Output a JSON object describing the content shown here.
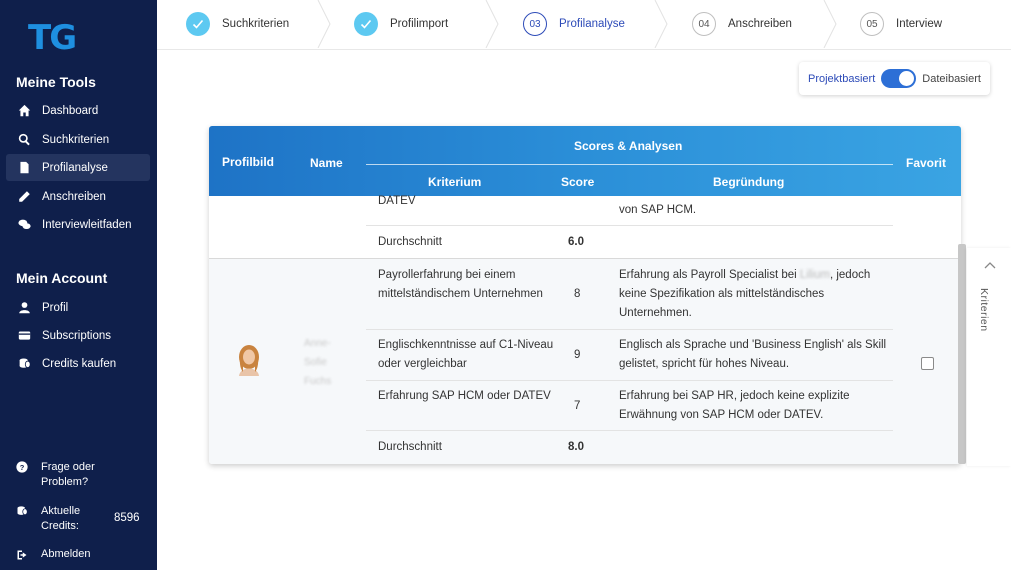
{
  "brand": {
    "logo": "TG"
  },
  "sidebar": {
    "tools_title": "Meine Tools",
    "tools": [
      {
        "label": "Dashboard",
        "icon": "home-icon"
      },
      {
        "label": "Suchkriterien",
        "icon": "search-icon"
      },
      {
        "label": "Profilanalyse",
        "icon": "file-icon",
        "active": true
      },
      {
        "label": "Anschreiben",
        "icon": "pencil-icon"
      },
      {
        "label": "Interviewleitfaden",
        "icon": "chat-icon"
      }
    ],
    "account_title": "Mein Account",
    "account": [
      {
        "label": "Profil",
        "icon": "user-icon"
      },
      {
        "label": "Subscriptions",
        "icon": "card-icon"
      },
      {
        "label": "Credits kaufen",
        "icon": "coins-icon"
      }
    ],
    "help_label": "Frage oder Problem?",
    "credits_label": "Aktuelle Credits:",
    "credits_value": "8596",
    "logout_label": "Abmelden"
  },
  "stepper": {
    "steps": [
      {
        "label": "Suchkriterien",
        "state": "done"
      },
      {
        "label": "Profilimport",
        "state": "done"
      },
      {
        "number": "03",
        "label": "Profilanalyse",
        "state": "active"
      },
      {
        "number": "04",
        "label": "Anschreiben",
        "state": "todo"
      },
      {
        "number": "05",
        "label": "Interview",
        "state": "todo"
      }
    ]
  },
  "toggle": {
    "left_label": "Projektbasiert",
    "right_label": "Dateibasiert",
    "state": "Dateibasiert"
  },
  "table": {
    "headers": {
      "profilbild": "Profilbild",
      "name": "Name",
      "group": "Scores & Analysen",
      "kriterium": "Kriterium",
      "score": "Score",
      "begruendung": "Begründung",
      "favorit": "Favorit"
    },
    "row1": {
      "partial_kriterium": "DATEV",
      "partial_begruendung": "von SAP HCM.",
      "avg_label": "Durchschnitt",
      "avg_value": "6.0"
    },
    "row2": {
      "name": "Anne-Sofie Fuchs",
      "criteria": [
        {
          "kriterium": "Payrollerfahrung bei einem mittelständischem Unternehmen",
          "score": "8",
          "begruendung_pre": "Erfahrung als Payroll Specialist bei ",
          "begruendung_blur": "Lilium",
          "begruendung_post": ", jedoch keine Spezifikation als mittelständisches Unternehmen."
        },
        {
          "kriterium": "Englischkenntnisse auf C1-Niveau oder vergleichbar",
          "score": "9",
          "begruendung": "Englisch als Sprache und 'Business English' als Skill gelistet, spricht für hohes Niveau."
        },
        {
          "kriterium": "Erfahrung SAP HCM oder DATEV",
          "score": "7",
          "begruendung": "Erfahrung bei SAP HR, jedoch keine explizite Erwähnung von SAP HCM oder DATEV."
        }
      ],
      "avg_label": "Durchschnitt",
      "avg_value": "8.0"
    }
  },
  "side_panel": {
    "label": "Kriterien"
  },
  "colors": {
    "sidebar": "#0f1f4b",
    "accent": "#2d4bb8",
    "header_gradient_start": "#1e73c6",
    "header_gradient_end": "#3aa4e3",
    "step_done": "#5dc9f1"
  }
}
